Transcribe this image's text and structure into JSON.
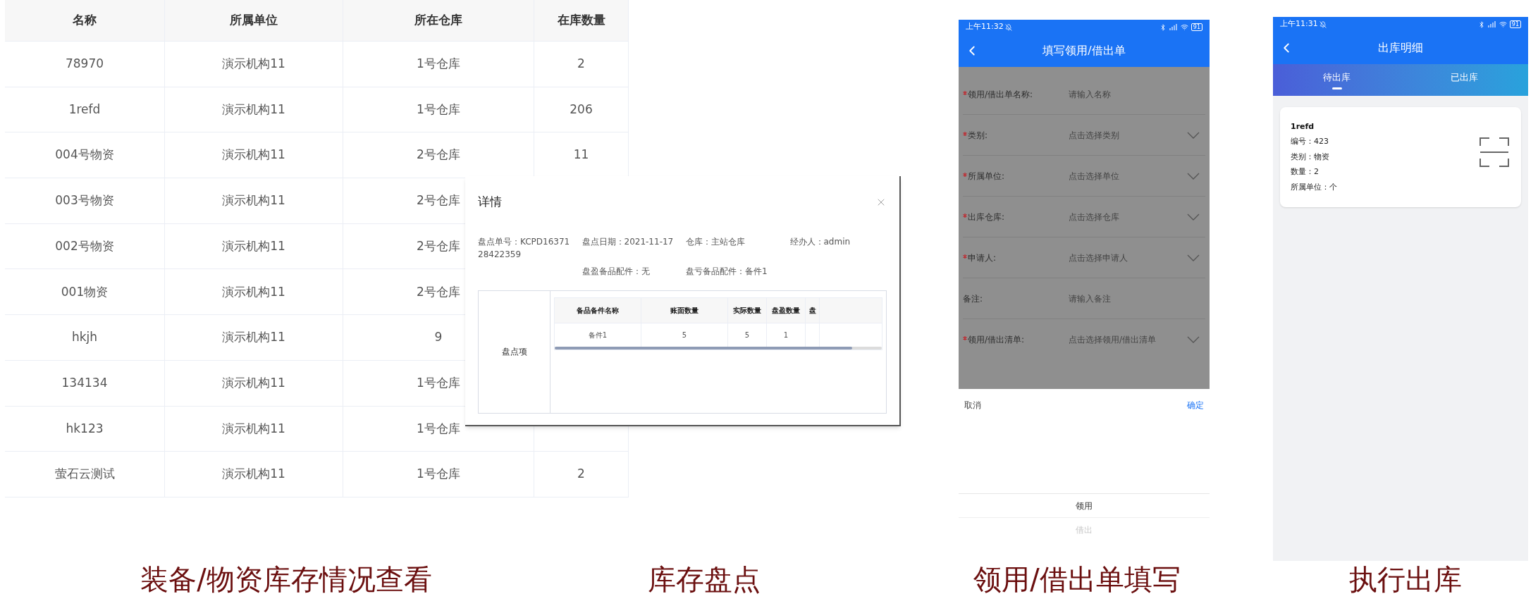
{
  "inventory_table": {
    "columns": [
      "名称",
      "所属单位",
      "所在仓库",
      "在库数量"
    ],
    "rows": [
      {
        "name": "78970",
        "unit": "演示机构11",
        "warehouse": "1号仓库",
        "quantity": "2"
      },
      {
        "name": "1refd",
        "unit": "演示机构11",
        "warehouse": "1号仓库",
        "quantity": "206"
      },
      {
        "name": "004号物资",
        "unit": "演示机构11",
        "warehouse": "2号仓库",
        "quantity": "11"
      },
      {
        "name": "003号物资",
        "unit": "演示机构11",
        "warehouse": "2号仓库"
      },
      {
        "name": "002号物资",
        "unit": "演示机构11",
        "warehouse": "2号仓库"
      },
      {
        "name": "001物资",
        "unit": "演示机构11",
        "warehouse": "2号仓库"
      },
      {
        "name": "hkjh",
        "unit": "演示机构11",
        "warehouse": "9"
      },
      {
        "name": "134134",
        "unit": "演示机构11",
        "warehouse": "1号仓库"
      },
      {
        "name": "hk123",
        "unit": "演示机构11",
        "warehouse": "1号仓库"
      },
      {
        "name": "萤石云测试",
        "unit": "演示机构11",
        "warehouse": "1号仓库",
        "quantity": "2"
      }
    ]
  },
  "detail_dialog": {
    "title": "详情",
    "info_row_1": [
      "盘点单号：KCPD1637128422359",
      "盘点日期：2021-11-17",
      "仓库：主站仓库",
      "经办人：admin"
    ],
    "info_row_2": [
      "盘盈备品配件：无",
      "盘亏备品配件：备件1"
    ],
    "section_label": "盘点项",
    "columns": [
      "备品备件名称",
      "账面数量",
      "实际数量",
      "盘盈数量",
      "盘"
    ],
    "rows": [
      [
        "备件1",
        "5",
        "5",
        "1"
      ]
    ]
  },
  "borrow_form_phone": {
    "status_time": "上午11:32",
    "battery": "91",
    "title": "填写领用/借出单",
    "fields": [
      {
        "label": "领用/借出单名称:",
        "placeholder": "请输入名称",
        "required": true,
        "kind": "input"
      },
      {
        "label": "类别:",
        "placeholder": "点击选择类别",
        "required": true,
        "kind": "select"
      },
      {
        "label": "所属单位:",
        "placeholder": "点击选择单位",
        "required": true,
        "kind": "select"
      },
      {
        "label": "出库仓库:",
        "placeholder": "点击选择仓库",
        "required": true,
        "kind": "select"
      },
      {
        "label": "申请人:",
        "placeholder": "点击选择申请人",
        "required": true,
        "kind": "select"
      },
      {
        "label": "备注:",
        "placeholder": "请输入备注",
        "required": false,
        "kind": "input"
      },
      {
        "label": "领用/借出清单:",
        "placeholder": "点击选择领用/借出清单",
        "required": true,
        "kind": "select"
      }
    ],
    "picker": {
      "cancel": "取消",
      "confirm": "确定",
      "options": [
        {
          "label": "领用",
          "selected": true
        },
        {
          "label": "借出",
          "selected": false
        }
      ]
    }
  },
  "outbound_phone": {
    "status_time": "上午11:31",
    "battery": "91",
    "title": "出库明细",
    "tabs": [
      {
        "label": "待出库",
        "selected": true
      },
      {
        "label": "已出库",
        "selected": false
      }
    ],
    "cards": [
      {
        "title": "1refd",
        "lines": [
          "编号：423",
          "类别：物资",
          "数量：2",
          "所属单位：个"
        ]
      }
    ]
  },
  "captions": [
    "装备/物资库存情况查看",
    "库存盘点",
    "领用/借出单填写",
    "执行出库"
  ]
}
